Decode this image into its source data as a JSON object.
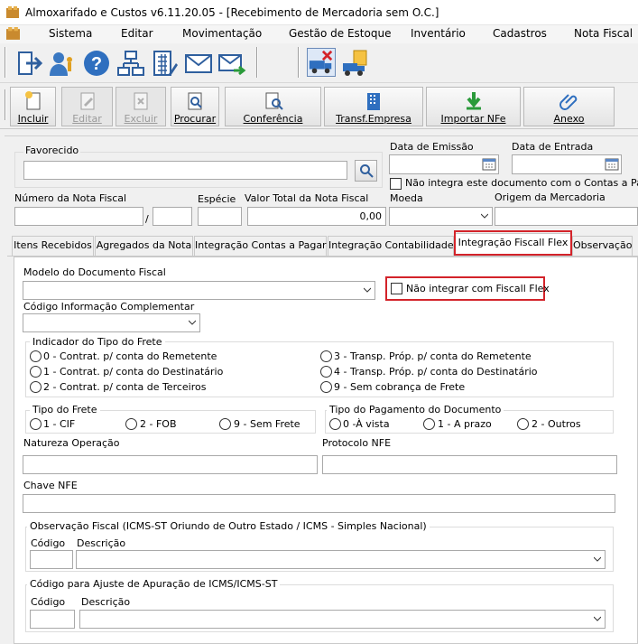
{
  "window": {
    "title": "Almoxarifado e Custos v6.11.20.05 - [Recebimento de Mercadoria sem O.C.]"
  },
  "menu": [
    "Sistema",
    "Editar",
    "Movimentação",
    "Gestão de Estoque",
    "Inventário",
    "Cadastros",
    "Nota Fiscal"
  ],
  "toolbar_icons": [
    "exit-icon",
    "users-icon",
    "help-icon",
    "org-chart-icon",
    "calculator-icon",
    "mail-icon",
    "send-mail-icon",
    "truck-cancel-icon",
    "truck-docs-icon"
  ],
  "actions": {
    "incluir": "Incluir",
    "editar": "Editar",
    "excluir": "Excluir",
    "procurar": "Procurar",
    "conferencia": "Conferência",
    "transf": "Transf.Empresa",
    "importar": "Importar NFe",
    "anexo": "Anexo"
  },
  "header": {
    "favorecido_label": "Favorecido",
    "data_emissao_label": "Data de Emissão",
    "data_entrada_label": "Data de Entrada",
    "nao_integra_label": "Não integra este documento com o Contas a Pagar",
    "numero_nf_label": "Número da Nota Fiscal",
    "separator": "/",
    "especie_label": "Espécie",
    "valor_total_label": "Valor Total da Nota Fiscal",
    "valor_total_value": "0,00",
    "moeda_label": "Moeda",
    "origem_label": "Origem da Mercadoria"
  },
  "tabs": [
    "Itens Recebidos",
    "Agregados da Nota",
    "Integração Contas a Pagar",
    "Integração Contabilidade",
    "Integração Fiscall Flex",
    "Observação"
  ],
  "fiscal": {
    "modelo_label": "Modelo do Documento Fiscal",
    "nao_integrar_label": "Não integrar com Fiscall Flex",
    "cod_info_label": "Código Informação Complementar",
    "frete_group": "Indicador do Tipo do Frete",
    "frete_options": [
      "0 - Contrat. p/ conta do Remetente",
      "1 - Contrat. p/ conta do Destinatário",
      "2 - Contrat. p/ conta de Terceiros",
      "3 - Transp. Próp. p/ conta do Remetente",
      "4 - Transp. Próp. p/ conta do Destinatário",
      "9 - Sem cobrança de Frete"
    ],
    "tipo_frete_group": "Tipo do Frete",
    "tipo_frete_options": [
      "1 - CIF",
      "2 - FOB",
      "9 - Sem Frete"
    ],
    "tipo_pag_group": "Tipo do Pagamento do Documento",
    "tipo_pag_options": [
      "0 -À vista",
      "1 - A prazo",
      "2 - Outros"
    ],
    "natureza_label": "Natureza Operação",
    "protocolo_label": "Protocolo NFE",
    "chave_label": "Chave NFE",
    "obs_group": "Observação Fiscal (ICMS-ST Oriundo de Outro Estado / ICMS - Simples Nacional)",
    "obs_codigo": "Código",
    "obs_descricao": "Descrição",
    "ajuste_group": "Código para Ajuste de Apuração de ICMS/ICMS-ST",
    "ajuste_codigo": "Código",
    "ajuste_descricao": "Descrição"
  },
  "colors": {
    "highlight": "#d3232a",
    "accent": "#3a78c2"
  }
}
